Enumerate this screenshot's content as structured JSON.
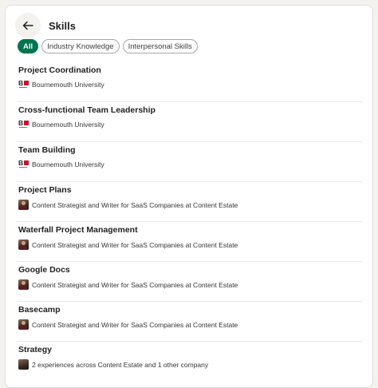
{
  "header": {
    "title": "Skills"
  },
  "filters": [
    {
      "label": "All",
      "active": true
    },
    {
      "label": "Industry Knowledge",
      "active": false
    },
    {
      "label": "Interpersonal Skills",
      "active": false
    }
  ],
  "skills": [
    {
      "name": "Project Coordination",
      "source": "Bournemouth University",
      "logo": "bournemouth-university-logo"
    },
    {
      "name": "Cross-functional Team Leadership",
      "source": "Bournemouth University",
      "logo": "bournemouth-university-logo"
    },
    {
      "name": "Team Building",
      "source": "Bournemouth University",
      "logo": "bournemouth-university-logo"
    },
    {
      "name": "Project Plans",
      "source": "Content Strategist and Writer for SaaS Companies at Content Estate",
      "logo": "content-estate-logo"
    },
    {
      "name": "Waterfall Project Management",
      "source": "Content Strategist and Writer for SaaS Companies at Content Estate",
      "logo": "content-estate-logo"
    },
    {
      "name": "Google Docs",
      "source": "Content Strategist and Writer for SaaS Companies at Content Estate",
      "logo": "content-estate-logo"
    },
    {
      "name": "Basecamp",
      "source": "Content Strategist and Writer for SaaS Companies at Content Estate",
      "logo": "content-estate-logo"
    },
    {
      "name": "Strategy",
      "source": "2 experiences across Content Estate and 1 other company",
      "logo": "multiple-experiences-logo"
    }
  ],
  "colors": {
    "accent": "#01754f",
    "background": "#f4f2ee"
  }
}
